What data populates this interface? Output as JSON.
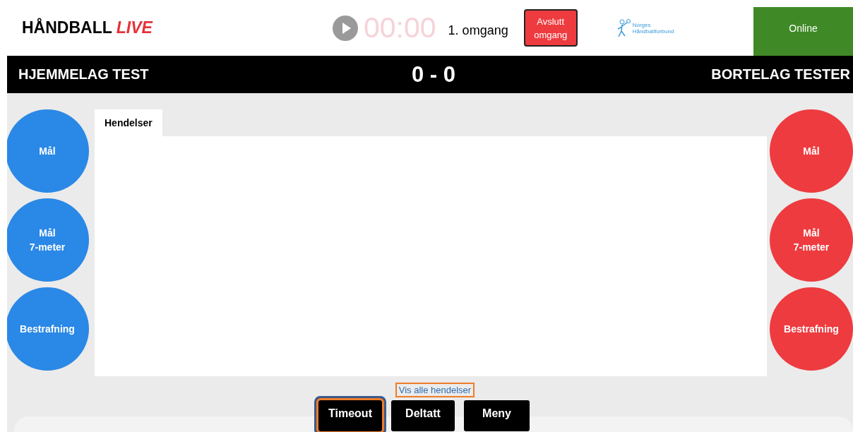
{
  "header": {
    "logo": {
      "main": "HÅNDBALL",
      "accent": "LIVE"
    },
    "timer": "00:00",
    "period": "1. omgang",
    "end_button": "Avslutt omgang",
    "federation": {
      "line1": "Norges",
      "line2": "Håndballforbund"
    },
    "status": "Online"
  },
  "score": "0 - 0",
  "teams": [
    {
      "name": "HJEMMELAG TEST",
      "color": "#2a88e6",
      "actions": [
        "Mål",
        "Mål\n7-meter",
        "Bestrafning"
      ]
    },
    {
      "name": "BORTELAG TESTER",
      "color": "#ee3b3f",
      "actions": [
        "Mål",
        "Mål\n7-meter",
        "Bestrafning"
      ]
    }
  ],
  "events": {
    "tabs": [
      {
        "label": "Hendelser",
        "selected": true
      }
    ],
    "link": {
      "label": "Vis alle hendelser",
      "highlighted": true
    }
  },
  "bottom_buttons": [
    {
      "label": "Timeout",
      "highlighted": true
    },
    {
      "label": "Deltatt",
      "highlighted": false
    },
    {
      "label": "Meny",
      "highlighted": false
    }
  ]
}
